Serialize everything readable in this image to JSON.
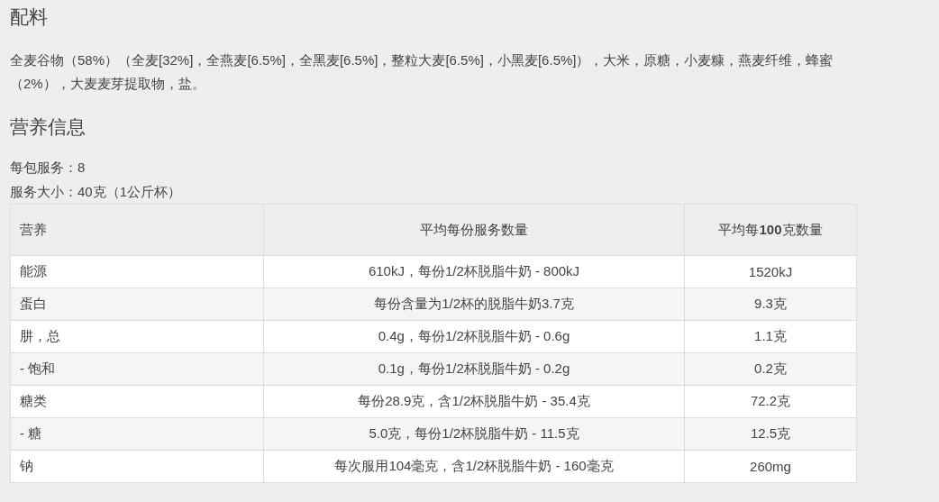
{
  "ingredients": {
    "title": "配料",
    "text": "全麦谷物（58%）（全麦[32%]，全燕麦[6.5%]，全黑麦[6.5%]，整粒大麦[6.5%]，小黑麦[6.5%]），大米，原糖，小麦糠，燕麦纤维，蜂蜜（2%），大麦麦芽提取物，盐。"
  },
  "nutrition": {
    "title": "营养信息",
    "servings_per_pack": "每包服务：8",
    "serving_size": "服务大小：40克（1公斤杯）",
    "table": {
      "columns": [
        "营养",
        "平均每份服务数量",
        "平均每**100**克数量"
      ],
      "rows": [
        [
          "能源",
          "610kJ，每份1/2杯脱脂牛奶 - 800kJ",
          "1520kJ"
        ],
        [
          "蛋白",
          "每份含量为1/2杯的脱脂牛奶3.7克",
          "9.3克"
        ],
        [
          "肼，总",
          "0.4g，每份1/2杯脱脂牛奶 - 0.6g",
          "1.1克"
        ],
        [
          "- 饱和",
          "0.1g，每份1/2杯脱脂牛奶 - 0.2g",
          "0.2克"
        ],
        [
          "糖类",
          "每份28.9克，含1/2杯脱脂牛奶 - 35.4克",
          "72.2克"
        ],
        [
          "- 糖",
          "5.0克，每份1/2杯脱脂牛奶 - 11.5克",
          "12.5克"
        ],
        [
          "钠",
          "每次服用104毫克，含1/2杯脱脂牛奶 - 160毫克",
          "260mg"
        ]
      ]
    }
  }
}
